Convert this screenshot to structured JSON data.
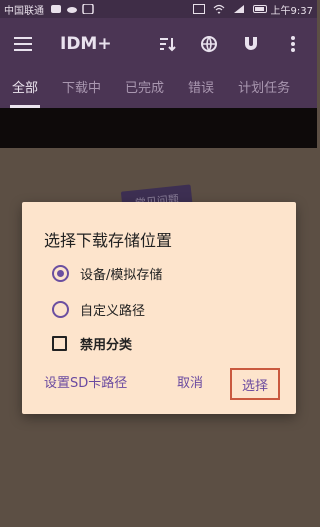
{
  "status_bar": {
    "carrier": "中国联通",
    "time": "上午9:37"
  },
  "app_bar": {
    "title": "IDM+",
    "icons": [
      "menu-icon",
      "sort-icon",
      "globe-icon",
      "magnet-icon",
      "more-vertical-icon"
    ]
  },
  "tabs": [
    {
      "label": "全部",
      "active": true
    },
    {
      "label": "下载中"
    },
    {
      "label": "已完成"
    },
    {
      "label": "错误"
    },
    {
      "label": "计划任务"
    }
  ],
  "background": {
    "badge_text": "常见问题"
  },
  "dialog": {
    "title": "选择下载存储位置",
    "options": [
      {
        "type": "radio",
        "label": "设备/模拟存储",
        "checked": true
      },
      {
        "type": "radio",
        "label": "自定义路径",
        "checked": false
      },
      {
        "type": "checkbox",
        "label": "禁用分类",
        "checked": false
      }
    ],
    "buttons": {
      "sd_path": "设置SD卡路径",
      "cancel": "取消",
      "select": "选择"
    }
  },
  "colors": {
    "appbar": "#4b3554",
    "dialog_bg": "#fde4cc",
    "accent": "#6b4fa0",
    "highlight_border": "#c9593f"
  }
}
